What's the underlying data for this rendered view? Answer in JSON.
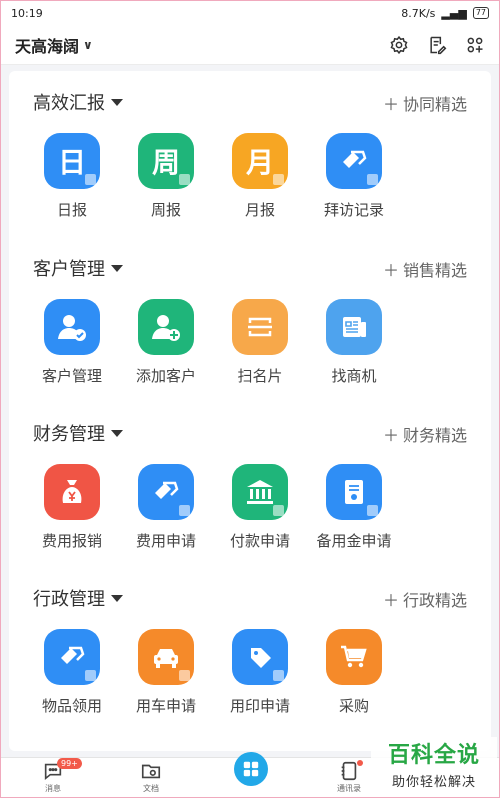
{
  "status_bar": {
    "time": "10:19",
    "speed": "8.7K/s",
    "battery": "77"
  },
  "header": {
    "company": "天高海阔"
  },
  "icons": {
    "settings": "gear-icon",
    "edit": "edit-note-icon",
    "grid": "apps-grid-icon"
  },
  "sections": [
    {
      "title": "高效汇报",
      "link": "协同精选",
      "apps": [
        {
          "label": "日报",
          "glyph": "日",
          "color": "#2f8ef5"
        },
        {
          "label": "周报",
          "glyph": "周",
          "color": "#1fb57a"
        },
        {
          "label": "月报",
          "glyph": "月",
          "color": "#f7a623"
        },
        {
          "label": "拜访记录",
          "glyph": "",
          "color": "#2f8ef5"
        }
      ]
    },
    {
      "title": "客户管理",
      "link": "销售精选",
      "apps": [
        {
          "label": "客户管理",
          "glyph": "",
          "color": "#2f8ef5"
        },
        {
          "label": "添加客户",
          "glyph": "",
          "color": "#1fb57a"
        },
        {
          "label": "扫名片",
          "glyph": "",
          "color": "#f7a84a"
        },
        {
          "label": "找商机",
          "glyph": "",
          "color": "#4ea3ee"
        }
      ]
    },
    {
      "title": "财务管理",
      "link": "财务精选",
      "apps": [
        {
          "label": "费用报销",
          "glyph": "",
          "color": "#f05545"
        },
        {
          "label": "费用申请",
          "glyph": "",
          "color": "#2f8ef5"
        },
        {
          "label": "付款申请",
          "glyph": "",
          "color": "#1fb57a"
        },
        {
          "label": "备用金申请",
          "glyph": "",
          "color": "#2f8ef5"
        }
      ]
    },
    {
      "title": "行政管理",
      "link": "行政精选",
      "apps": [
        {
          "label": "物品领用",
          "glyph": "",
          "color": "#2f8ef5"
        },
        {
          "label": "用车申请",
          "glyph": "",
          "color": "#f58a2a"
        },
        {
          "label": "用印申请",
          "glyph": "",
          "color": "#2f8ef5"
        },
        {
          "label": "采购",
          "glyph": "",
          "color": "#f58a2a"
        }
      ]
    }
  ],
  "bottom_nav": {
    "messages": "消息",
    "messages_badge": "99+",
    "docs": "文档",
    "contacts": "通讯录"
  },
  "watermark": {
    "main": "百科全说",
    "sub": "助你轻松解决"
  }
}
